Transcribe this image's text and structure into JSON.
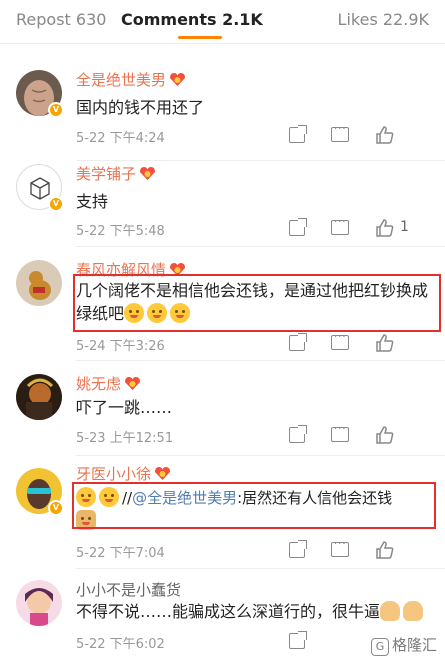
{
  "tabs": {
    "repost_label": "Repost",
    "repost_count": "630",
    "comments_label": "Comments",
    "comments_count": "2.1K",
    "likes_label": "Likes",
    "likes_count": "22.9K"
  },
  "comments": [
    {
      "username": "全是绝世美男",
      "text": "国内的钱不用还了",
      "time": "5-22 下午4:24",
      "likes": ""
    },
    {
      "username": "美学铺子",
      "text": "支持",
      "time": "5-22 下午5:48",
      "likes": "1"
    },
    {
      "username": "春风亦解风情",
      "text": "几个阔佬不是相信他会还钱，是通过他把红钞换成绿纸吧",
      "time": "5-24 下午3:26",
      "likes": ""
    },
    {
      "username": "姚无虑",
      "text": "吓了一跳……",
      "time": "5-23 上午12:51",
      "likes": ""
    },
    {
      "username": "牙医小小徐",
      "separator": "//",
      "mention": "@全是绝世美男",
      "text": ":居然还有人信他会还钱",
      "time": "5-22 下午7:04",
      "likes": ""
    },
    {
      "username": "小小不是小蠢货",
      "text": "不得不说……能骗成这么深道行的，很牛逼",
      "time": "5-22 下午6:02",
      "likes": ""
    }
  ],
  "watermark": "格隆汇",
  "icons": [
    "share-icon",
    "comment-icon",
    "like-icon",
    "vip-badge-icon"
  ],
  "colors": {
    "accent": "#ff8200",
    "username": "#eb7350",
    "mention": "#507daf",
    "highlight": "#e0312f"
  }
}
